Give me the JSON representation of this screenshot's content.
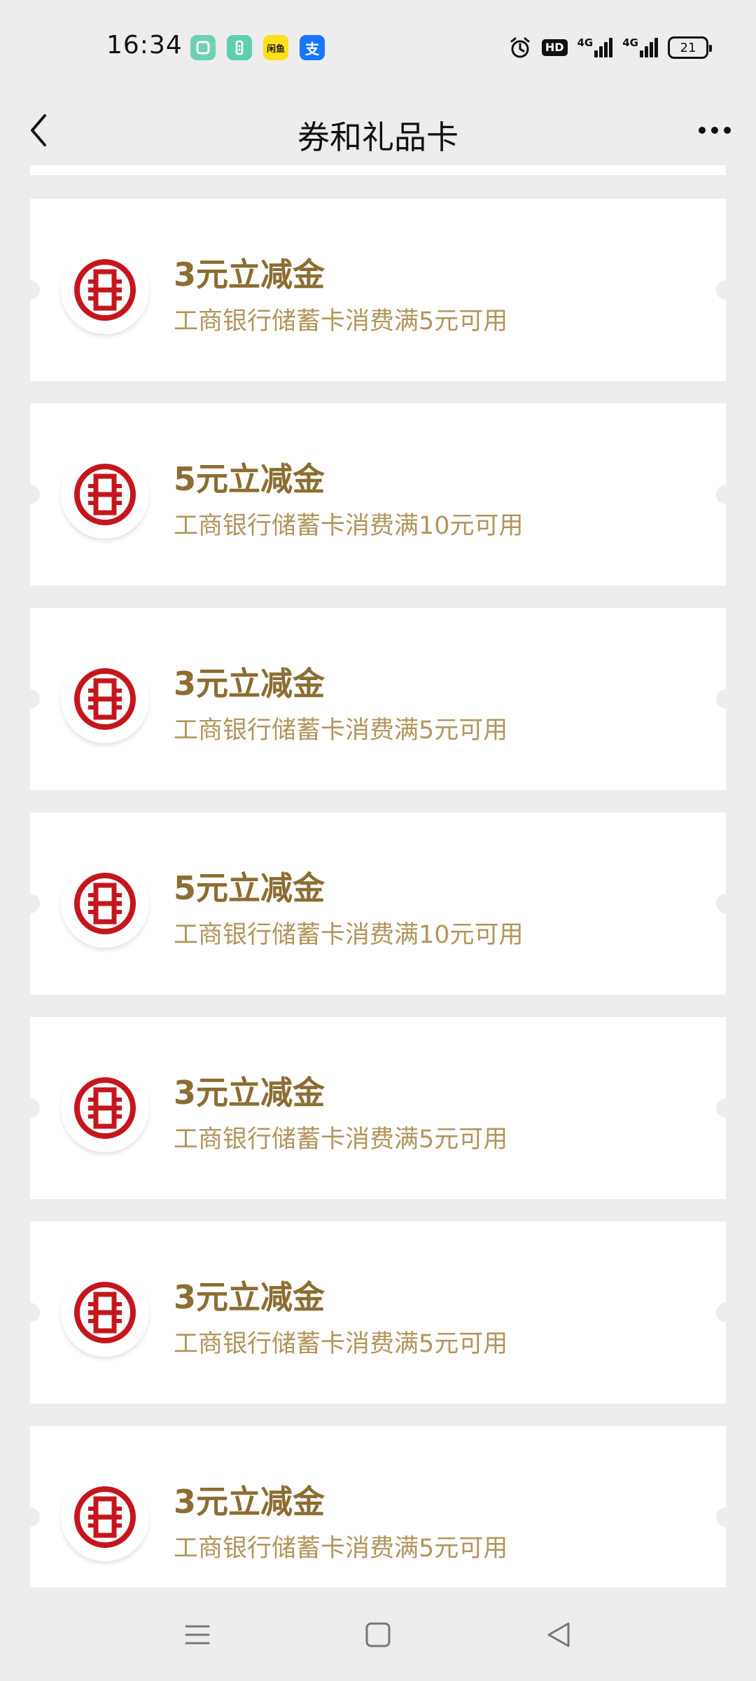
{
  "status_bar": {
    "time": "16:34",
    "apps": [
      {
        "name": "app-green",
        "color": "#6fd0b4",
        "label": ""
      },
      {
        "name": "app-teal",
        "color": "#5fcfb0",
        "label": ""
      },
      {
        "name": "app-yellow",
        "color": "#ffe01a",
        "label": "闲鱼"
      },
      {
        "name": "alipay",
        "color": "#1677ff",
        "label": "支"
      }
    ],
    "hd_label": "HD",
    "net1_label": "4G",
    "net2_label": "4G",
    "battery_level": "21"
  },
  "nav": {
    "title": "券和礼品卡"
  },
  "colors": {
    "title_gold": "#8c6d32",
    "desc_gold": "#b2955d",
    "icbc_red": "#c4161c",
    "background": "#ededed"
  },
  "coupons": [
    {
      "title": "3元立减金",
      "desc": "工商银行储蓄卡消费满5元可用",
      "icon": "icbc-logo-icon"
    },
    {
      "title": "5元立减金",
      "desc": "工商银行储蓄卡消费满10元可用",
      "icon": "icbc-logo-icon"
    },
    {
      "title": "3元立减金",
      "desc": "工商银行储蓄卡消费满5元可用",
      "icon": "icbc-logo-icon"
    },
    {
      "title": "5元立减金",
      "desc": "工商银行储蓄卡消费满10元可用",
      "icon": "icbc-logo-icon"
    },
    {
      "title": "3元立减金",
      "desc": "工商银行储蓄卡消费满5元可用",
      "icon": "icbc-logo-icon"
    },
    {
      "title": "3元立减金",
      "desc": "工商银行储蓄卡消费满5元可用",
      "icon": "icbc-logo-icon"
    },
    {
      "title": "3元立减金",
      "desc": "工商银行储蓄卡消费满5元可用",
      "icon": "icbc-logo-icon"
    }
  ],
  "system_nav": [
    "menu-icon",
    "home-icon",
    "back-triangle-icon"
  ]
}
